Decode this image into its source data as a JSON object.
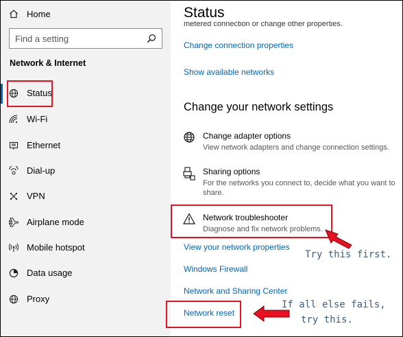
{
  "sidebar": {
    "home_label": "Home",
    "search_placeholder": "Find a setting",
    "section_title": "Network & Internet",
    "items": [
      {
        "label": "Status"
      },
      {
        "label": "Wi-Fi"
      },
      {
        "label": "Ethernet"
      },
      {
        "label": "Dial-up"
      },
      {
        "label": "VPN"
      },
      {
        "label": "Airplane mode"
      },
      {
        "label": "Mobile hotspot"
      },
      {
        "label": "Data usage"
      },
      {
        "label": "Proxy"
      }
    ]
  },
  "main": {
    "title": "Status",
    "cut_text": "metered connection or change other properties.",
    "links_top": {
      "change_connection": "Change connection properties",
      "show_networks": "Show available networks"
    },
    "section_heading": "Change your network settings",
    "options": [
      {
        "title": "Change adapter options",
        "desc": "View network adapters and change connection settings."
      },
      {
        "title": "Sharing options",
        "desc": "For the networks you connect to, decide what you want to share."
      },
      {
        "title": "Network troubleshooter",
        "desc": "Diagnose and fix network problems."
      }
    ],
    "links_bottom": {
      "view_properties": "View your network properties",
      "firewall": "Windows Firewall",
      "sharing_center": "Network and Sharing Center",
      "network_reset": "Network reset"
    }
  },
  "annotations": {
    "try_first": "Try this first.",
    "else_fails_line1": "If all else fails,",
    "else_fails_line2": "try this."
  },
  "colors": {
    "accent_link": "#0066b4",
    "highlight_red": "#e81123",
    "annotation_text": "#3d5e82",
    "selected_indicator": "#0067c0"
  }
}
